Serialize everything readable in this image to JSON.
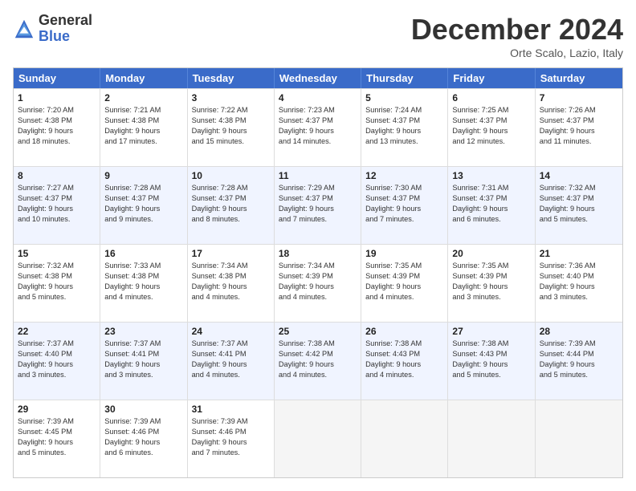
{
  "header": {
    "logo_line1": "General",
    "logo_line2": "Blue",
    "month": "December 2024",
    "location": "Orte Scalo, Lazio, Italy"
  },
  "weekdays": [
    "Sunday",
    "Monday",
    "Tuesday",
    "Wednesday",
    "Thursday",
    "Friday",
    "Saturday"
  ],
  "rows": [
    [
      {
        "day": "1",
        "lines": [
          "Sunrise: 7:20 AM",
          "Sunset: 4:38 PM",
          "Daylight: 9 hours",
          "and 18 minutes."
        ]
      },
      {
        "day": "2",
        "lines": [
          "Sunrise: 7:21 AM",
          "Sunset: 4:38 PM",
          "Daylight: 9 hours",
          "and 17 minutes."
        ]
      },
      {
        "day": "3",
        "lines": [
          "Sunrise: 7:22 AM",
          "Sunset: 4:38 PM",
          "Daylight: 9 hours",
          "and 15 minutes."
        ]
      },
      {
        "day": "4",
        "lines": [
          "Sunrise: 7:23 AM",
          "Sunset: 4:37 PM",
          "Daylight: 9 hours",
          "and 14 minutes."
        ]
      },
      {
        "day": "5",
        "lines": [
          "Sunrise: 7:24 AM",
          "Sunset: 4:37 PM",
          "Daylight: 9 hours",
          "and 13 minutes."
        ]
      },
      {
        "day": "6",
        "lines": [
          "Sunrise: 7:25 AM",
          "Sunset: 4:37 PM",
          "Daylight: 9 hours",
          "and 12 minutes."
        ]
      },
      {
        "day": "7",
        "lines": [
          "Sunrise: 7:26 AM",
          "Sunset: 4:37 PM",
          "Daylight: 9 hours",
          "and 11 minutes."
        ]
      }
    ],
    [
      {
        "day": "8",
        "lines": [
          "Sunrise: 7:27 AM",
          "Sunset: 4:37 PM",
          "Daylight: 9 hours",
          "and 10 minutes."
        ]
      },
      {
        "day": "9",
        "lines": [
          "Sunrise: 7:28 AM",
          "Sunset: 4:37 PM",
          "Daylight: 9 hours",
          "and 9 minutes."
        ]
      },
      {
        "day": "10",
        "lines": [
          "Sunrise: 7:28 AM",
          "Sunset: 4:37 PM",
          "Daylight: 9 hours",
          "and 8 minutes."
        ]
      },
      {
        "day": "11",
        "lines": [
          "Sunrise: 7:29 AM",
          "Sunset: 4:37 PM",
          "Daylight: 9 hours",
          "and 7 minutes."
        ]
      },
      {
        "day": "12",
        "lines": [
          "Sunrise: 7:30 AM",
          "Sunset: 4:37 PM",
          "Daylight: 9 hours",
          "and 7 minutes."
        ]
      },
      {
        "day": "13",
        "lines": [
          "Sunrise: 7:31 AM",
          "Sunset: 4:37 PM",
          "Daylight: 9 hours",
          "and 6 minutes."
        ]
      },
      {
        "day": "14",
        "lines": [
          "Sunrise: 7:32 AM",
          "Sunset: 4:37 PM",
          "Daylight: 9 hours",
          "and 5 minutes."
        ]
      }
    ],
    [
      {
        "day": "15",
        "lines": [
          "Sunrise: 7:32 AM",
          "Sunset: 4:38 PM",
          "Daylight: 9 hours",
          "and 5 minutes."
        ]
      },
      {
        "day": "16",
        "lines": [
          "Sunrise: 7:33 AM",
          "Sunset: 4:38 PM",
          "Daylight: 9 hours",
          "and 4 minutes."
        ]
      },
      {
        "day": "17",
        "lines": [
          "Sunrise: 7:34 AM",
          "Sunset: 4:38 PM",
          "Daylight: 9 hours",
          "and 4 minutes."
        ]
      },
      {
        "day": "18",
        "lines": [
          "Sunrise: 7:34 AM",
          "Sunset: 4:39 PM",
          "Daylight: 9 hours",
          "and 4 minutes."
        ]
      },
      {
        "day": "19",
        "lines": [
          "Sunrise: 7:35 AM",
          "Sunset: 4:39 PM",
          "Daylight: 9 hours",
          "and 4 minutes."
        ]
      },
      {
        "day": "20",
        "lines": [
          "Sunrise: 7:35 AM",
          "Sunset: 4:39 PM",
          "Daylight: 9 hours",
          "and 3 minutes."
        ]
      },
      {
        "day": "21",
        "lines": [
          "Sunrise: 7:36 AM",
          "Sunset: 4:40 PM",
          "Daylight: 9 hours",
          "and 3 minutes."
        ]
      }
    ],
    [
      {
        "day": "22",
        "lines": [
          "Sunrise: 7:37 AM",
          "Sunset: 4:40 PM",
          "Daylight: 9 hours",
          "and 3 minutes."
        ]
      },
      {
        "day": "23",
        "lines": [
          "Sunrise: 7:37 AM",
          "Sunset: 4:41 PM",
          "Daylight: 9 hours",
          "and 3 minutes."
        ]
      },
      {
        "day": "24",
        "lines": [
          "Sunrise: 7:37 AM",
          "Sunset: 4:41 PM",
          "Daylight: 9 hours",
          "and 4 minutes."
        ]
      },
      {
        "day": "25",
        "lines": [
          "Sunrise: 7:38 AM",
          "Sunset: 4:42 PM",
          "Daylight: 9 hours",
          "and 4 minutes."
        ]
      },
      {
        "day": "26",
        "lines": [
          "Sunrise: 7:38 AM",
          "Sunset: 4:43 PM",
          "Daylight: 9 hours",
          "and 4 minutes."
        ]
      },
      {
        "day": "27",
        "lines": [
          "Sunrise: 7:38 AM",
          "Sunset: 4:43 PM",
          "Daylight: 9 hours",
          "and 5 minutes."
        ]
      },
      {
        "day": "28",
        "lines": [
          "Sunrise: 7:39 AM",
          "Sunset: 4:44 PM",
          "Daylight: 9 hours",
          "and 5 minutes."
        ]
      }
    ],
    [
      {
        "day": "29",
        "lines": [
          "Sunrise: 7:39 AM",
          "Sunset: 4:45 PM",
          "Daylight: 9 hours",
          "and 5 minutes."
        ]
      },
      {
        "day": "30",
        "lines": [
          "Sunrise: 7:39 AM",
          "Sunset: 4:46 PM",
          "Daylight: 9 hours",
          "and 6 minutes."
        ]
      },
      {
        "day": "31",
        "lines": [
          "Sunrise: 7:39 AM",
          "Sunset: 4:46 PM",
          "Daylight: 9 hours",
          "and 7 minutes."
        ]
      },
      {
        "day": "",
        "lines": []
      },
      {
        "day": "",
        "lines": []
      },
      {
        "day": "",
        "lines": []
      },
      {
        "day": "",
        "lines": []
      }
    ]
  ]
}
